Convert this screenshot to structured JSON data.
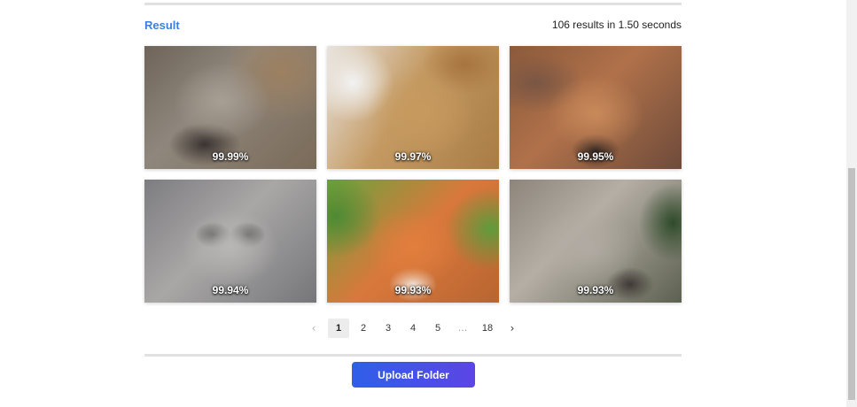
{
  "header": {
    "title": "Result",
    "meta": "106 results in 1.50 seconds"
  },
  "results": [
    {
      "score": "99.99%",
      "subject": "wolf"
    },
    {
      "score": "99.97%",
      "subject": "lion"
    },
    {
      "score": "99.95%",
      "subject": "fox"
    },
    {
      "score": "99.94%",
      "subject": "snow leopard cub"
    },
    {
      "score": "99.93%",
      "subject": "fox"
    },
    {
      "score": "99.93%",
      "subject": "wolf"
    }
  ],
  "pagination": {
    "prev_icon": "chevron-left-icon",
    "next_icon": "chevron-right-icon",
    "pages": [
      "1",
      "2",
      "3",
      "4",
      "5",
      "…",
      "18"
    ],
    "current": "1"
  },
  "actions": {
    "upload_label": "Upload Folder"
  },
  "colors": {
    "accent": "#3b7fe0",
    "button_start": "#2f5fe8",
    "button_end": "#5c45e6"
  }
}
